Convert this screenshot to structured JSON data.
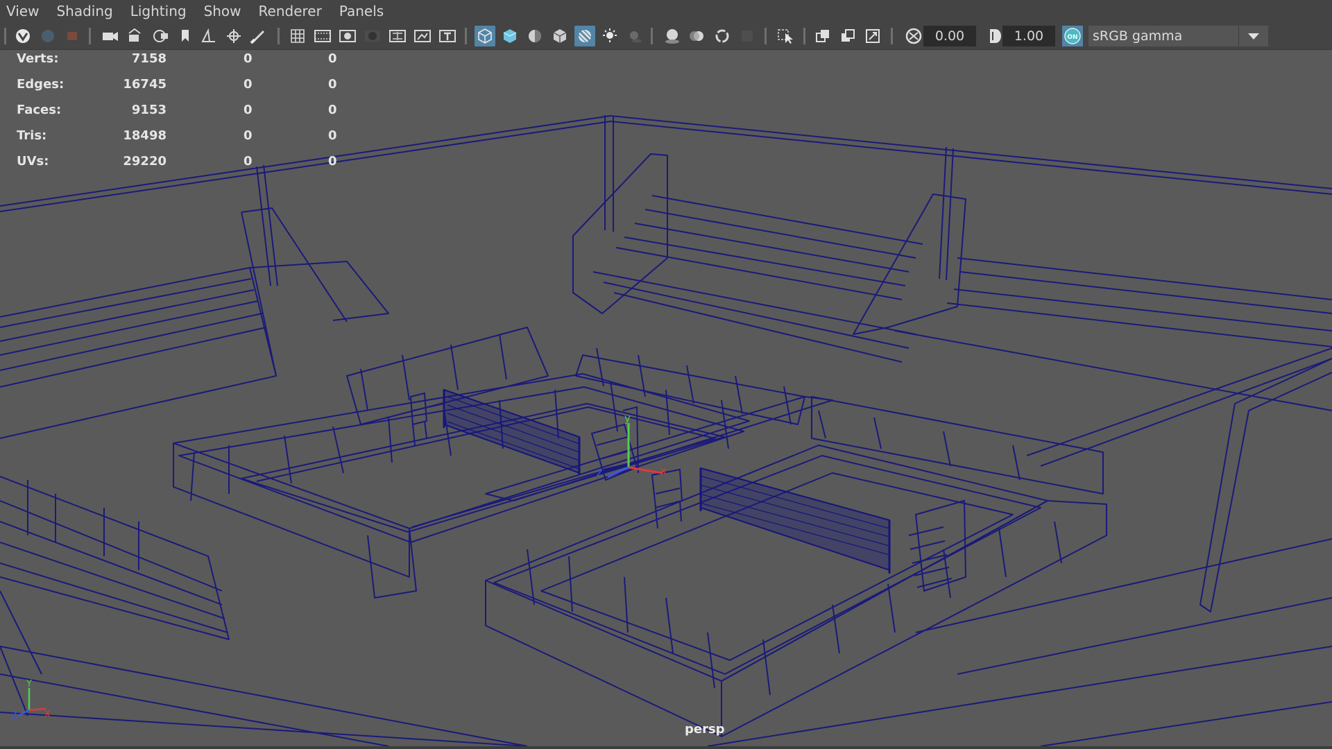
{
  "menubar": {
    "items": [
      "View",
      "Shading",
      "Lighting",
      "Show",
      "Renderer",
      "Panels"
    ]
  },
  "toolbar": {
    "icons": [
      "select-camera-icon",
      "lock-camera-icon",
      "camera-attributes-icon",
      "camera-icon",
      "camera-bookmark-icon",
      "image-plane-icon",
      "2d-pan-zoom-icon",
      "grease-pencil-icon",
      "grid-icon",
      "film-gate-icon",
      "resolution-gate-icon",
      "gate-mask-icon",
      "field-chart-icon",
      "safe-action-icon",
      "safe-title-icon",
      "wireframe-icon",
      "smooth-shade-icon",
      "default-material-icon",
      "wireframe-on-shaded-icon",
      "xray-icon",
      "use-all-lights-icon",
      "shadows-icon",
      "screen-space-ao-icon",
      "motion-blur-icon",
      "multisample-aa-icon",
      "depth-of-field-icon",
      "isolate-select-icon",
      "xray-joints-icon",
      "xray-active-icon",
      "backface-culling-icon",
      "exposure-icon",
      "gamma-icon",
      "color-management-icon"
    ],
    "exposure_value": "0.00",
    "gamma_value": "1.00",
    "color_mgmt_badge": "ON",
    "view_transform": "sRGB gamma"
  },
  "hud": {
    "rows": [
      {
        "label": "Verts:",
        "v1": "7158",
        "v2": "0",
        "v3": "0"
      },
      {
        "label": "Edges:",
        "v1": "16745",
        "v2": "0",
        "v3": "0"
      },
      {
        "label": "Faces:",
        "v1": "9153",
        "v2": "0",
        "v3": "0"
      },
      {
        "label": "Tris:",
        "v1": "18498",
        "v2": "0",
        "v3": "0"
      },
      {
        "label": "UVs:",
        "v1": "29220",
        "v2": "0",
        "v3": "0"
      }
    ]
  },
  "viewport": {
    "camera_name": "persp",
    "wire_color": "#1a1a7a",
    "bg_color": "#5a5a5a"
  },
  "axis": {
    "labels": {
      "x": "X",
      "y": "Y",
      "z": "Z"
    }
  }
}
